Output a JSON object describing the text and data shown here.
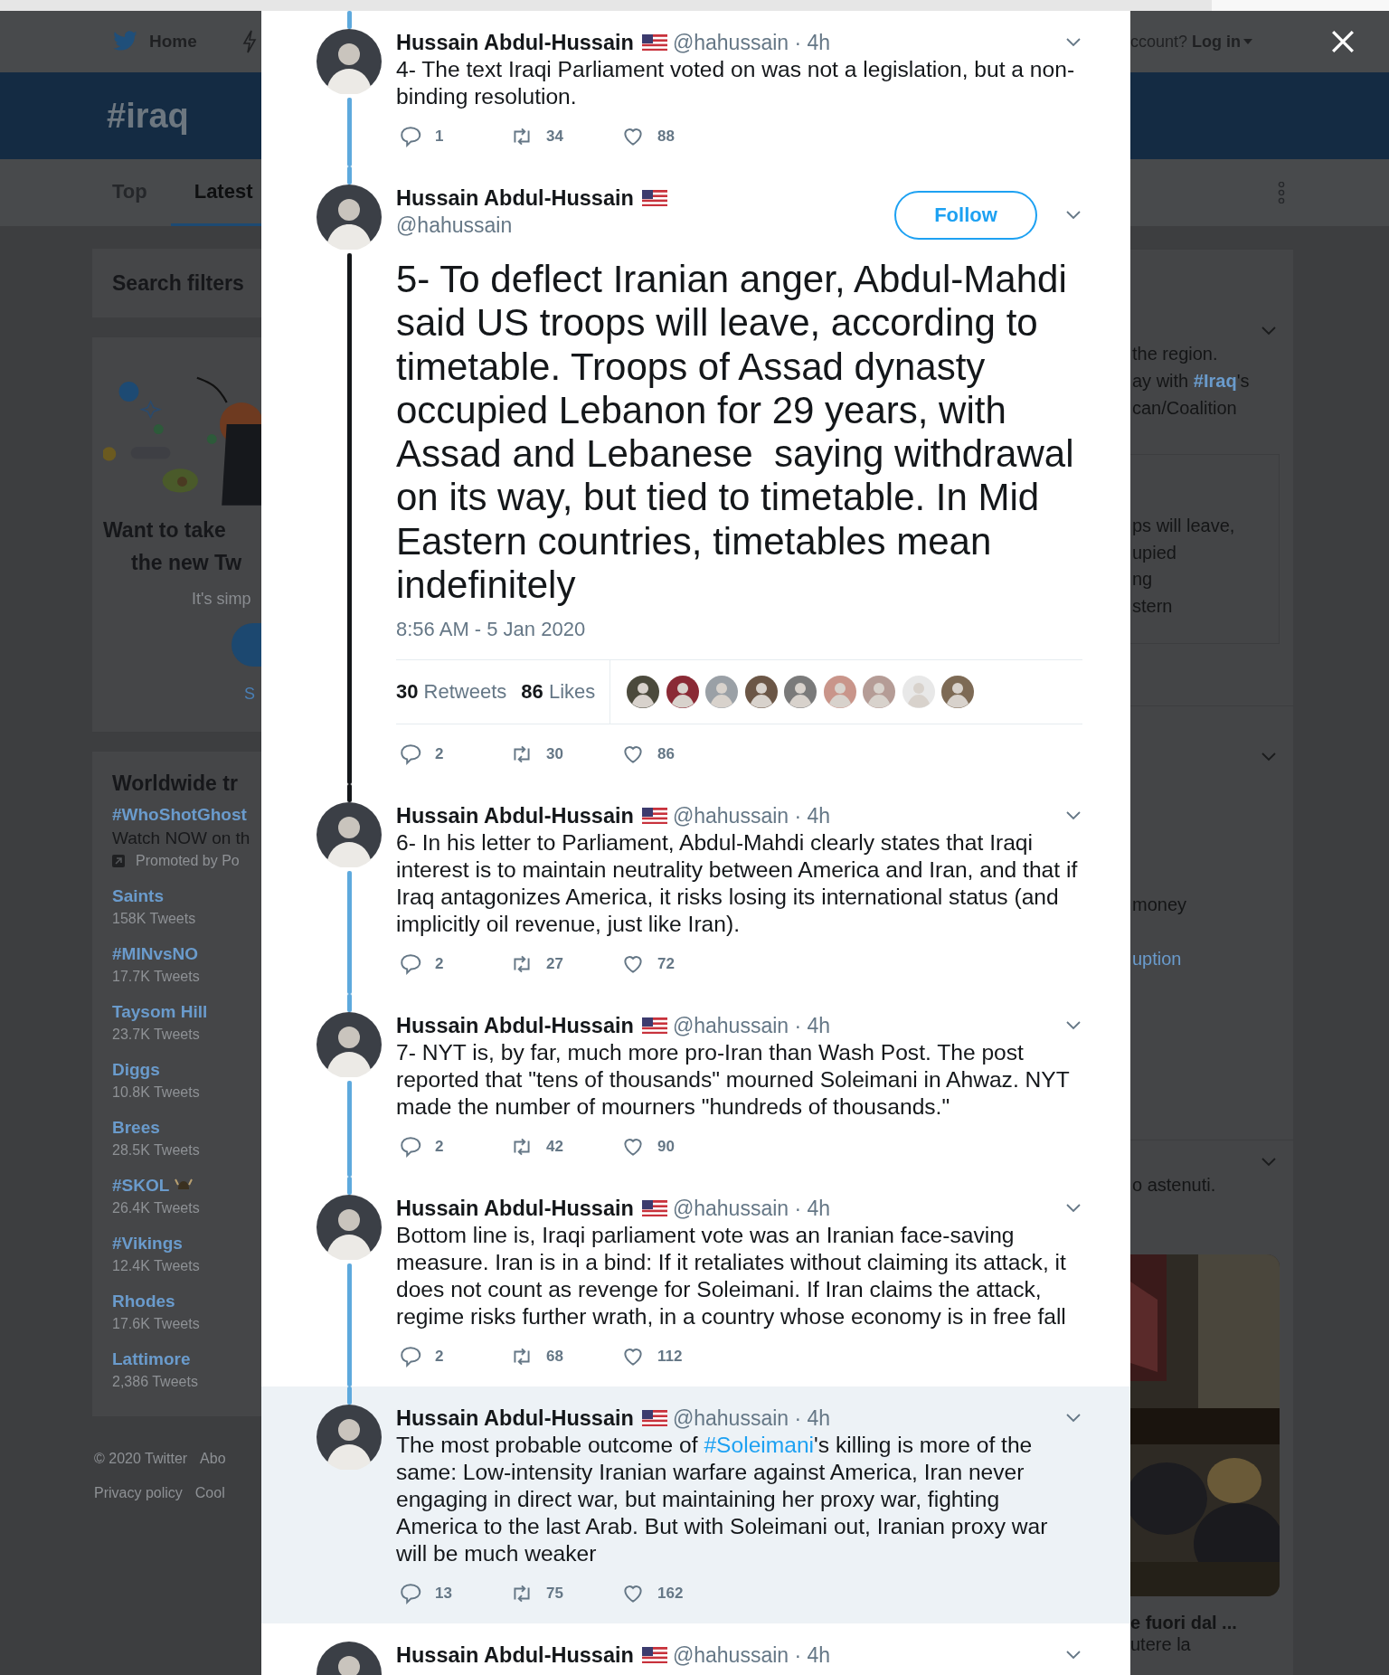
{
  "background": {
    "nav": {
      "home": "Home",
      "login_prompt": "ccount?",
      "login": "Log in"
    },
    "header_title": "#iraq",
    "tabs": [
      {
        "label": "Top",
        "selected": false
      },
      {
        "label": "Latest",
        "selected": true
      }
    ],
    "search_filters": "Search filters",
    "promo": {
      "title_lines": [
        "Want to take",
        "the new Tw"
      ],
      "subtitle": "It's simp",
      "link": "S"
    },
    "trends": {
      "title": "Worldwide tr",
      "promoted": {
        "name": "#WhoShotGhost",
        "text": "Watch NOW on th",
        "by": "Promoted by Po"
      },
      "items": [
        {
          "name": "Saints",
          "count": "158K Tweets"
        },
        {
          "name": "#MINvsNO",
          "count": "17.7K Tweets"
        },
        {
          "name": "Taysom Hill",
          "count": "23.7K Tweets"
        },
        {
          "name": "Diggs",
          "count": "10.8K Tweets"
        },
        {
          "name": "Brees",
          "count": "28.5K Tweets"
        },
        {
          "name": "#SKOL",
          "count": "26.4K Tweets",
          "emoji": true
        },
        {
          "name": "#Vikings",
          "count": "12.4K Tweets"
        },
        {
          "name": "Rhodes",
          "count": "17.6K Tweets"
        },
        {
          "name": "Lattimore",
          "count": "2,386 Tweets"
        }
      ]
    },
    "footer": [
      [
        "© 2020 Twitter",
        "Abo"
      ],
      [
        "Privacy policy",
        "Cool"
      ]
    ],
    "right_cards": [
      {
        "lines": [
          [
            {
              "kind": "plain",
              "text": "the region."
            }
          ],
          [
            {
              "kind": "plain",
              "text": "ay with "
            },
            {
              "kind": "hashtag",
              "text": "#Iraq"
            },
            {
              "kind": "plain",
              "text": "'s"
            }
          ],
          [
            {
              "kind": "plain",
              "text": "can/Coalition"
            }
          ]
        ],
        "quote_lines": [
          "ps will leave,",
          "upied",
          "ng",
          "stern"
        ]
      },
      {
        "lines": [
          [
            {
              "kind": "plain",
              "text": "money"
            }
          ],
          [
            {
              "kind": "hashtag",
              "text": "uption"
            }
          ]
        ]
      },
      {
        "lines": [
          [
            {
              "kind": "plain",
              "text": "o astenuti."
            }
          ]
        ],
        "media": {
          "kind": "picture"
        },
        "card_title": "e fuori dal ...",
        "card_text": "utere la"
      }
    ]
  },
  "modal": {
    "tweets": [
      {
        "kind": "reply",
        "connected_above": true,
        "connected_below": true,
        "highlighted": false,
        "author": "Hussain Abdul-Hussain",
        "meta": "@hahussain · 4h",
        "text": "4- The text Iraqi Parliament voted on was not a legislation, but a non-binding resolution.",
        "replies": "1",
        "retweets": "34",
        "likes": "88"
      },
      {
        "kind": "focused",
        "connected_above": true,
        "connected_below": true,
        "highlighted": false,
        "author": "Hussain Abdul-Hussain",
        "meta": "@hahussain",
        "follow": "Follow",
        "text": "5- To deflect Iranian anger, Abdul-Mahdi said US troops will leave, according to timetable. Troops of Assad dynasty occupied Lebanon for 29 years, with Assad and Lebanese  saying withdrawal on its way, but tied to timetable. In Mid Eastern countries, timetables mean indefinitely",
        "timestamp": "8:56 AM - 5 Jan 2020",
        "stats": {
          "retweets": "30",
          "retweets_label": "Retweets",
          "likes": "86",
          "likes_label": "Likes"
        },
        "liker_avatars": [
          {
            "color": "#4b4a3c"
          },
          {
            "color": "#8a2a35"
          },
          {
            "color": "#9aa0a6"
          },
          {
            "color": "#6b5646"
          },
          {
            "color": "#7a7a7a"
          },
          {
            "color": "#c9958a"
          },
          {
            "color": "#b59c96"
          },
          {
            "color": "#e8e8e8"
          },
          {
            "color": "#7d6a55"
          }
        ],
        "replies": "2",
        "retweets": "30",
        "likes": "86"
      },
      {
        "kind": "reply",
        "connected_above": true,
        "connected_below": true,
        "highlighted": false,
        "author": "Hussain Abdul-Hussain",
        "meta": "@hahussain · 4h",
        "text": "6- In his letter to Parliament, Abdul-Mahdi clearly states that Iraqi interest is to maintain neutrality between America and Iran, and that if Iraq antagonizes America, it risks losing its international status (and implicitly oil revenue, just like Iran).",
        "replies": "2",
        "retweets": "27",
        "likes": "72"
      },
      {
        "kind": "reply",
        "connected_above": true,
        "connected_below": true,
        "highlighted": false,
        "author": "Hussain Abdul-Hussain",
        "meta": "@hahussain · 4h",
        "text": "7- NYT is, by far, much more pro-Iran than Wash Post. The post reported that \"tens of thousands\" mourned Soleimani in Ahwaz. NYT made the number of mourners \"hundreds of thousands.\"",
        "replies": "2",
        "retweets": "42",
        "likes": "90"
      },
      {
        "kind": "reply",
        "connected_above": true,
        "connected_below": true,
        "highlighted": false,
        "author": "Hussain Abdul-Hussain",
        "meta": "@hahussain · 4h",
        "text": "Bottom line is, Iraqi parliament vote was an Iranian face-saving measure. Iran is in a bind: If it retaliates without claiming its attack, it does not count as revenge for Soleimani. If Iran claims the attack, regime risks further wrath, in a country whose economy is in free fall",
        "replies": "2",
        "retweets": "68",
        "likes": "112"
      },
      {
        "kind": "reply",
        "connected_above": true,
        "connected_below": false,
        "highlighted": true,
        "author": "Hussain Abdul-Hussain",
        "meta": "@hahussain · 4h",
        "text": [
          {
            "kind": "plain",
            "text": "The most probable outcome of "
          },
          {
            "kind": "hashtag",
            "text": "#Soleimani"
          },
          {
            "kind": "plain",
            "text": "'s killing is more of the same: Low-intensity Iranian warfare against America, Iran never engaging in direct war, but maintaining her proxy war, fighting America to the last Arab. But with Soleimani out, Iranian proxy war will be much weaker"
          }
        ],
        "replies": "13",
        "retweets": "75",
        "likes": "162"
      },
      {
        "kind": "reply",
        "connected_above": false,
        "connected_below": false,
        "highlighted": false,
        "author": "Hussain Abdul-Hussain",
        "meta": "@hahussain · 4h"
      }
    ]
  }
}
